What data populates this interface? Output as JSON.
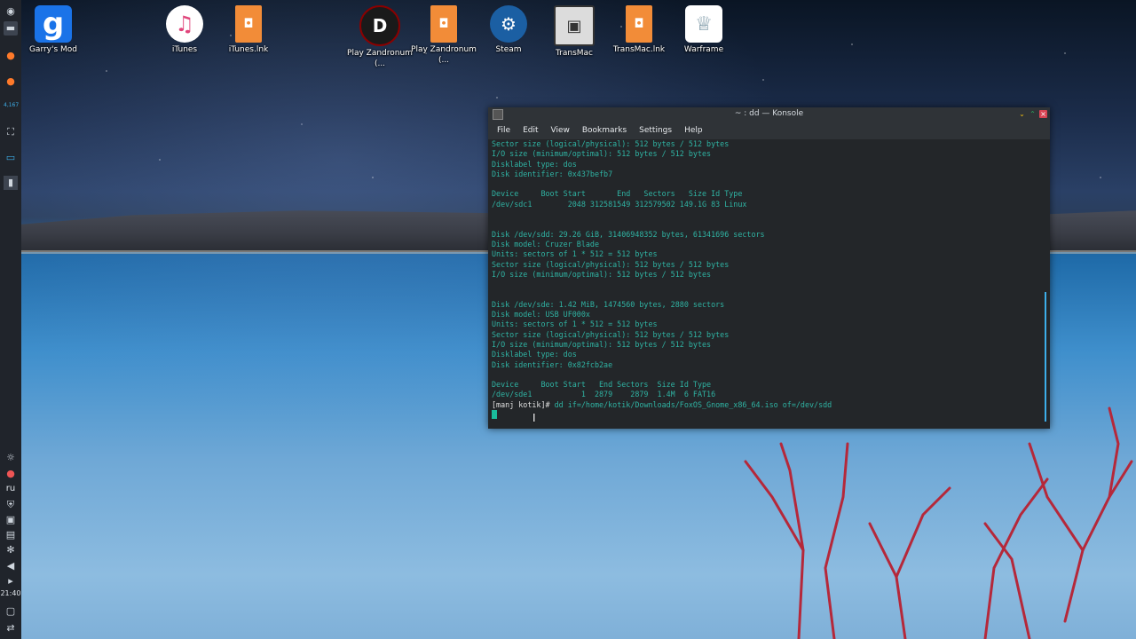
{
  "desktop": {
    "icons": [
      {
        "label": "Garry's Mod",
        "icon": "garrys-mod-icon",
        "color": "#1a73e8"
      },
      {
        "label": "iTunes",
        "icon": "itunes-icon",
        "color": "#ffffff"
      },
      {
        "label": "iTunes.lnk",
        "icon": "shortcut-file-icon",
        "color": "#f28c38"
      },
      {
        "label": "Play Zandronum (...",
        "icon": "zandronum-icon",
        "color": "#8b0000"
      },
      {
        "label": "Play Zandronum (...",
        "icon": "shortcut-file-icon",
        "color": "#f28c38"
      },
      {
        "label": "Steam",
        "icon": "steam-icon",
        "color": "#1b5fa3"
      },
      {
        "label": "TransMac",
        "icon": "transmac-icon",
        "color": "#333333"
      },
      {
        "label": "TransMac.lnk",
        "icon": "shortcut-file-icon",
        "color": "#f28c38"
      },
      {
        "label": "Warframe",
        "icon": "warframe-icon",
        "color": "#ffffff"
      }
    ]
  },
  "panel": {
    "language": "ru",
    "time": "21:40",
    "badge": "4,167"
  },
  "konsole": {
    "title": "~ : dd — Konsole",
    "menu": [
      "File",
      "Edit",
      "View",
      "Bookmarks",
      "Settings",
      "Help"
    ],
    "lines": [
      "Sector size (logical/physical): 512 bytes / 512 bytes",
      "I/O size (minimum/optimal): 512 bytes / 512 bytes",
      "Disklabel type: dos",
      "Disk identifier: 0x437befb7",
      "",
      "Device     Boot Start       End   Sectors   Size Id Type",
      "/dev/sdc1        2048 312581549 312579502 149.1G 83 Linux",
      "",
      "",
      "Disk /dev/sdd: 29.26 GiB, 31406948352 bytes, 61341696 sectors",
      "Disk model: Cruzer Blade",
      "Units: sectors of 1 * 512 = 512 bytes",
      "Sector size (logical/physical): 512 bytes / 512 bytes",
      "I/O size (minimum/optimal): 512 bytes / 512 bytes",
      "",
      "",
      "Disk /dev/sde: 1.42 MiB, 1474560 bytes, 2880 sectors",
      "Disk model: USB UF000x",
      "Units: sectors of 1 * 512 = 512 bytes",
      "Sector size (logical/physical): 512 bytes / 512 bytes",
      "I/O size (minimum/optimal): 512 bytes / 512 bytes",
      "Disklabel type: dos",
      "Disk identifier: 0x82fcb2ae",
      "",
      "Device     Boot Start   End Sectors  Size Id Type",
      "/dev/sde1           1  2879    2879  1.4M  6 FAT16"
    ],
    "prompt": "[manj kotik]#",
    "command": " dd if=/home/kotik/Downloads/FoxOS_Gnome_x86_64.iso of=/dev/sdd"
  }
}
